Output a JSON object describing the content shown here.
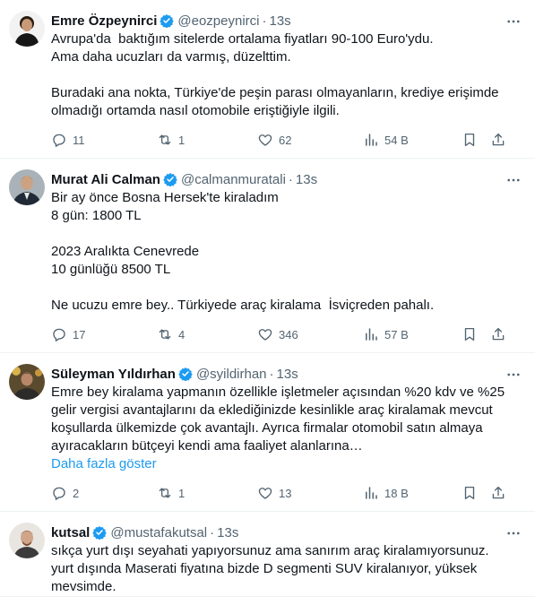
{
  "tweets": [
    {
      "name": "Emre Özpeynirci",
      "handle": "@eozpeynirci",
      "dot": "·",
      "time": "13s",
      "lines": [
        "Avrupa'da  baktığım sitelerde ortalama fiyatları 90-100 Euro'ydu.",
        "Ama daha ucuzları da varmış, düzelttim.",
        "",
        "Buradaki ana nokta, Türkiye'de peşin parası olmayanların, krediye erişimde",
        "olmadığı ortamda nasıl otomobile eriştiğiyle ilgili."
      ],
      "replies": "11",
      "retweets": "1",
      "likes": "62",
      "views": "54 B"
    },
    {
      "name": "Murat Ali Calman",
      "handle": "@calmanmuratali",
      "dot": "·",
      "time": "13s",
      "lines": [
        "Bir ay önce Bosna Hersek'te kiraladım",
        "8 gün: 1800 TL",
        "",
        "2023 Aralıkta Cenevrede",
        "10 günlüğü 8500 TL",
        "",
        "Ne ucuzu emre bey.. Türkiyede araç kiralama  İsviçreden pahalı."
      ],
      "replies": "17",
      "retweets": "4",
      "likes": "346",
      "views": "57 B"
    },
    {
      "name": "Süleyman Yıldırhan",
      "handle": "@syildirhan",
      "dot": "·",
      "time": "13s",
      "lines": [
        "Emre bey kiralama yapmanın özellikle işletmeler açısından %20 kdv ve %25",
        "gelir vergisi avantajlarını da eklediğinizde kesinlikle araç kiralamak mevcut",
        "koşullarda ülkemizde çok avantajlı. Ayrıca firmalar otomobil satın almaya",
        "ayıracakların bütçeyi kendi ama faaliyet alanlarına…"
      ],
      "show_more": "Daha fazla göster",
      "replies": "2",
      "retweets": "1",
      "likes": "13",
      "views": "18 B"
    },
    {
      "name": "kutsal",
      "handle": "@mustafakutsal",
      "dot": "·",
      "time": "13s",
      "lines": [
        "sıkça yurt dışı seyahati yapıyorsunuz ama sanırım araç kiralamıyorsunuz.",
        "yurt dışında Maserati fiyatına bizde D segmenti SUV kiralanıyor, yüksek",
        "mevsimde."
      ]
    }
  ],
  "colors": {
    "text": "#0f1419",
    "secondary": "#536471",
    "accent": "#1d9bf0",
    "border": "#eff3f4"
  },
  "icons": {
    "verified": "verified-badge-icon",
    "more": "more-dots-icon",
    "reply": "reply-icon",
    "retweet": "retweet-icon",
    "like": "heart-icon",
    "views": "views-chart-icon",
    "bookmark": "bookmark-icon",
    "share": "share-icon"
  }
}
